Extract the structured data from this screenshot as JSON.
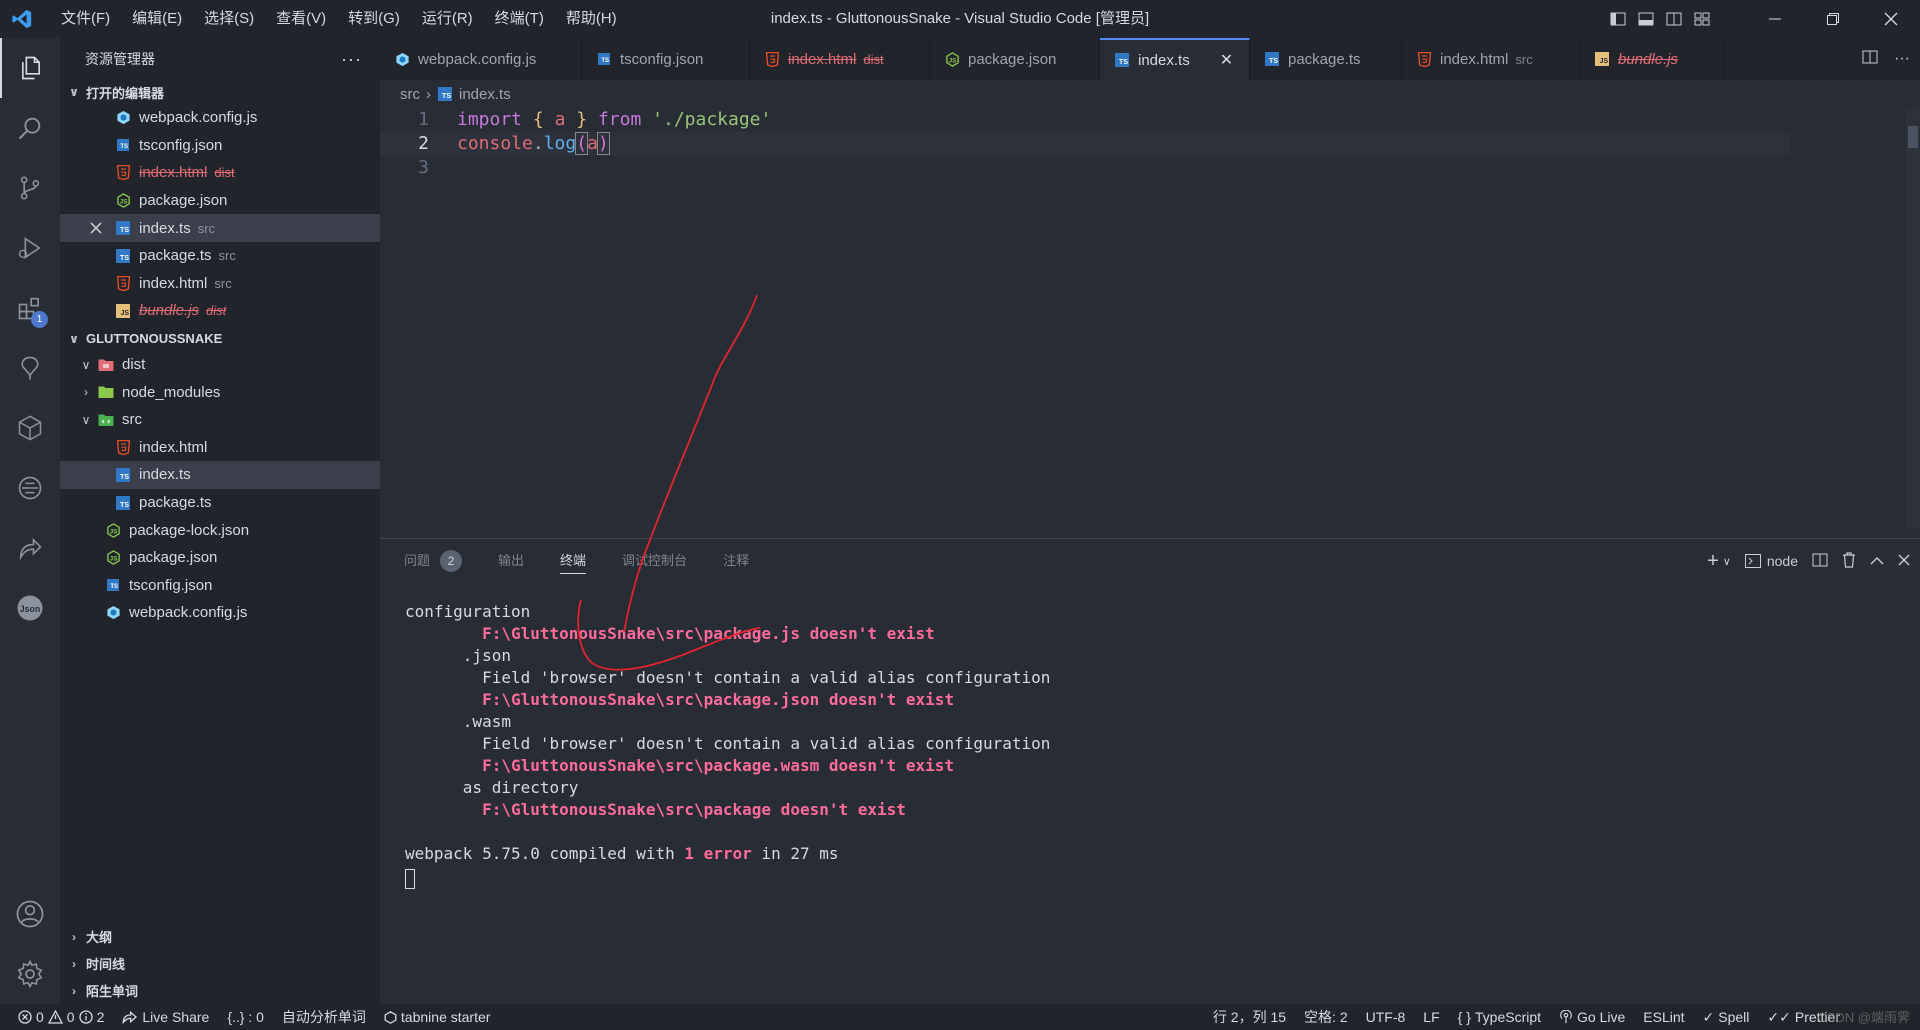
{
  "titlebar": {
    "menu": [
      "文件(F)",
      "编辑(E)",
      "选择(S)",
      "查看(V)",
      "转到(G)",
      "运行(R)",
      "终端(T)",
      "帮助(H)"
    ],
    "title": "index.ts - GluttonousSnake - Visual Studio Code [管理员]"
  },
  "sidebar": {
    "header": "资源管理器",
    "more": "···",
    "open_editors": {
      "title": "打开的编辑器",
      "items": [
        {
          "label": "webpack.config.js",
          "desc": ""
        },
        {
          "label": "tsconfig.json",
          "desc": ""
        },
        {
          "label": "index.html",
          "desc": "dist"
        },
        {
          "label": "package.json",
          "desc": ""
        },
        {
          "label": "index.ts",
          "desc": "src"
        },
        {
          "label": "package.ts",
          "desc": "src"
        },
        {
          "label": "index.html",
          "desc": "src"
        },
        {
          "label": "bundle.js",
          "desc": "dist"
        }
      ]
    },
    "project": {
      "title": "GLUTTONOUSSNAKE",
      "items": [
        {
          "label": "dist"
        },
        {
          "label": "node_modules"
        },
        {
          "label": "src"
        },
        {
          "label": "index.html"
        },
        {
          "label": "index.ts"
        },
        {
          "label": "package.ts"
        },
        {
          "label": "package-lock.json"
        },
        {
          "label": "package.json"
        },
        {
          "label": "tsconfig.json"
        },
        {
          "label": "webpack.config.js"
        }
      ]
    },
    "bottom_sections": [
      "大纲",
      "时间线",
      "陌生单词"
    ]
  },
  "activity": {
    "extensions_badge": "1"
  },
  "tabs": [
    {
      "label": "webpack.config.js",
      "desc": ""
    },
    {
      "label": "tsconfig.json",
      "desc": ""
    },
    {
      "label": "index.html",
      "desc": "dist"
    },
    {
      "label": "package.json",
      "desc": ""
    },
    {
      "label": "index.ts",
      "desc": ""
    },
    {
      "label": "package.ts",
      "desc": ""
    },
    {
      "label": "index.html",
      "desc": "src"
    },
    {
      "label": "bundle.js",
      "desc": ""
    }
  ],
  "breadcrumb": {
    "folder": "src",
    "file": "index.ts"
  },
  "editor": {
    "line_numbers": [
      "1",
      "2",
      "3"
    ],
    "line1": {
      "kw1": "import",
      "ob": "{",
      "var": "a",
      "cb": "}",
      "kw2": "from",
      "str": "'./package'"
    },
    "line2": {
      "obj": "console",
      "dot": ".",
      "fn": "log",
      "op": "(",
      "arg": "a",
      "cp": ")"
    }
  },
  "panel": {
    "tabs": [
      "问题",
      "输出",
      "终端",
      "调试控制台",
      "注释"
    ],
    "problems_count": "2",
    "shell": "node",
    "terminal": [
      {
        "text": "configuration",
        "style": "normal"
      },
      {
        "text": "        F:\\GluttonousSnake\\src\\package.js doesn't exist",
        "style": "red"
      },
      {
        "text": "      .json",
        "style": "normal"
      },
      {
        "text": "        Field 'browser' doesn't contain a valid alias configuration",
        "style": "normal"
      },
      {
        "text": "        F:\\GluttonousSnake\\src\\package.json doesn't exist",
        "style": "red"
      },
      {
        "text": "      .wasm",
        "style": "normal"
      },
      {
        "text": "        Field 'browser' doesn't contain a valid alias configuration",
        "style": "normal"
      },
      {
        "text": "        F:\\GluttonousSnake\\src\\package.wasm doesn't exist",
        "style": "red"
      },
      {
        "text": "      as directory",
        "style": "normal"
      },
      {
        "text": "        F:\\GluttonousSnake\\src\\package doesn't exist",
        "style": "red"
      },
      {
        "text": "",
        "style": "normal"
      }
    ],
    "compiled": {
      "prefix": "webpack 5.75.0 compiled with ",
      "err": "1 error",
      "suffix": " in 27 ms"
    }
  },
  "statusbar": {
    "errors": "0",
    "warnings": "0",
    "infos": "2",
    "live_share": "Live Share",
    "braces": "{..} : 0",
    "auto_words": "自动分析单词",
    "tabnine": "tabnine starter",
    "position": "行 2，列 15",
    "spaces": "空格: 2",
    "encoding": "UTF-8",
    "eol": "LF",
    "language": "TypeScript",
    "go_live": "Go Live",
    "eslint": "ESLint",
    "spell": "Spell",
    "prettier": "Prettier",
    "watermark": "CSDN @端雨霁"
  }
}
